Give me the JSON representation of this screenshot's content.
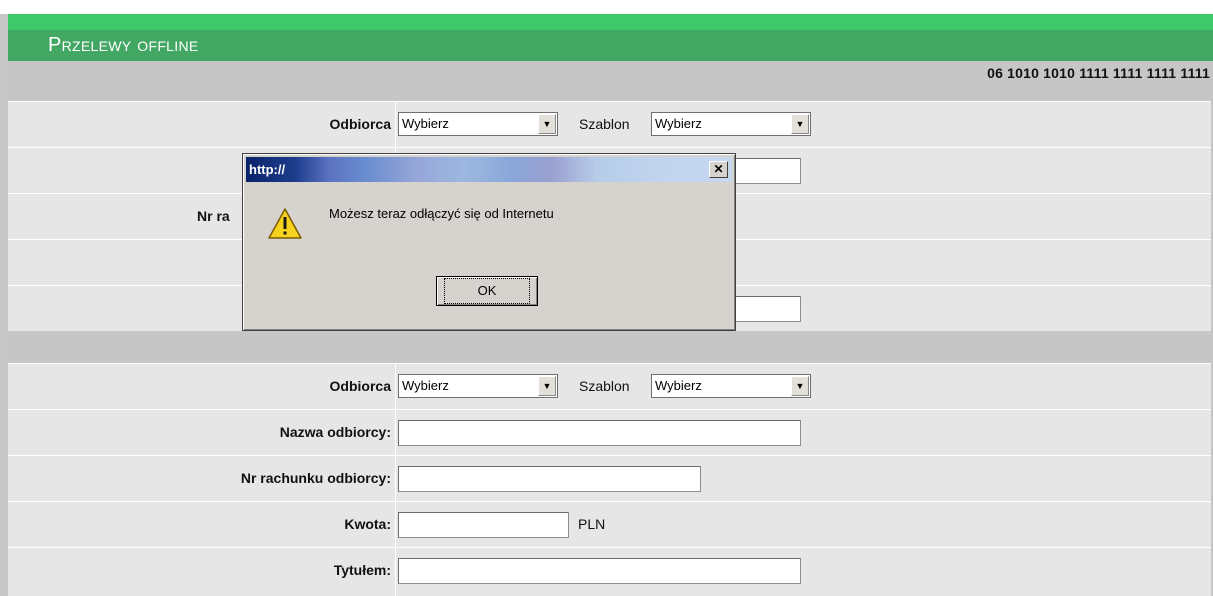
{
  "header": {
    "title": "Przelewy offline"
  },
  "account": {
    "number": "06 1010 1010 1111 1111 1111 1111"
  },
  "form1": {
    "recipient_label": "Odbiorca",
    "recipient_select": "Wybierz",
    "template_label": "Szablon",
    "template_select": "Wybierz",
    "account_label_partial": "Nr ra"
  },
  "form2": {
    "recipient_label": "Odbiorca",
    "recipient_select": "Wybierz",
    "template_label": "Szablon",
    "template_select": "Wybierz",
    "name_label": "Nazwa odbiorcy:",
    "account_label": "Nr rachunku odbiorcy:",
    "amount_label": "Kwota:",
    "currency": "PLN",
    "title_label": "Tytułem:"
  },
  "dialog": {
    "title": "http://",
    "message": "Możesz teraz odłączyć się od Internetu",
    "ok_label": "OK",
    "close_symbol": "✕",
    "icon": "warning-icon"
  }
}
